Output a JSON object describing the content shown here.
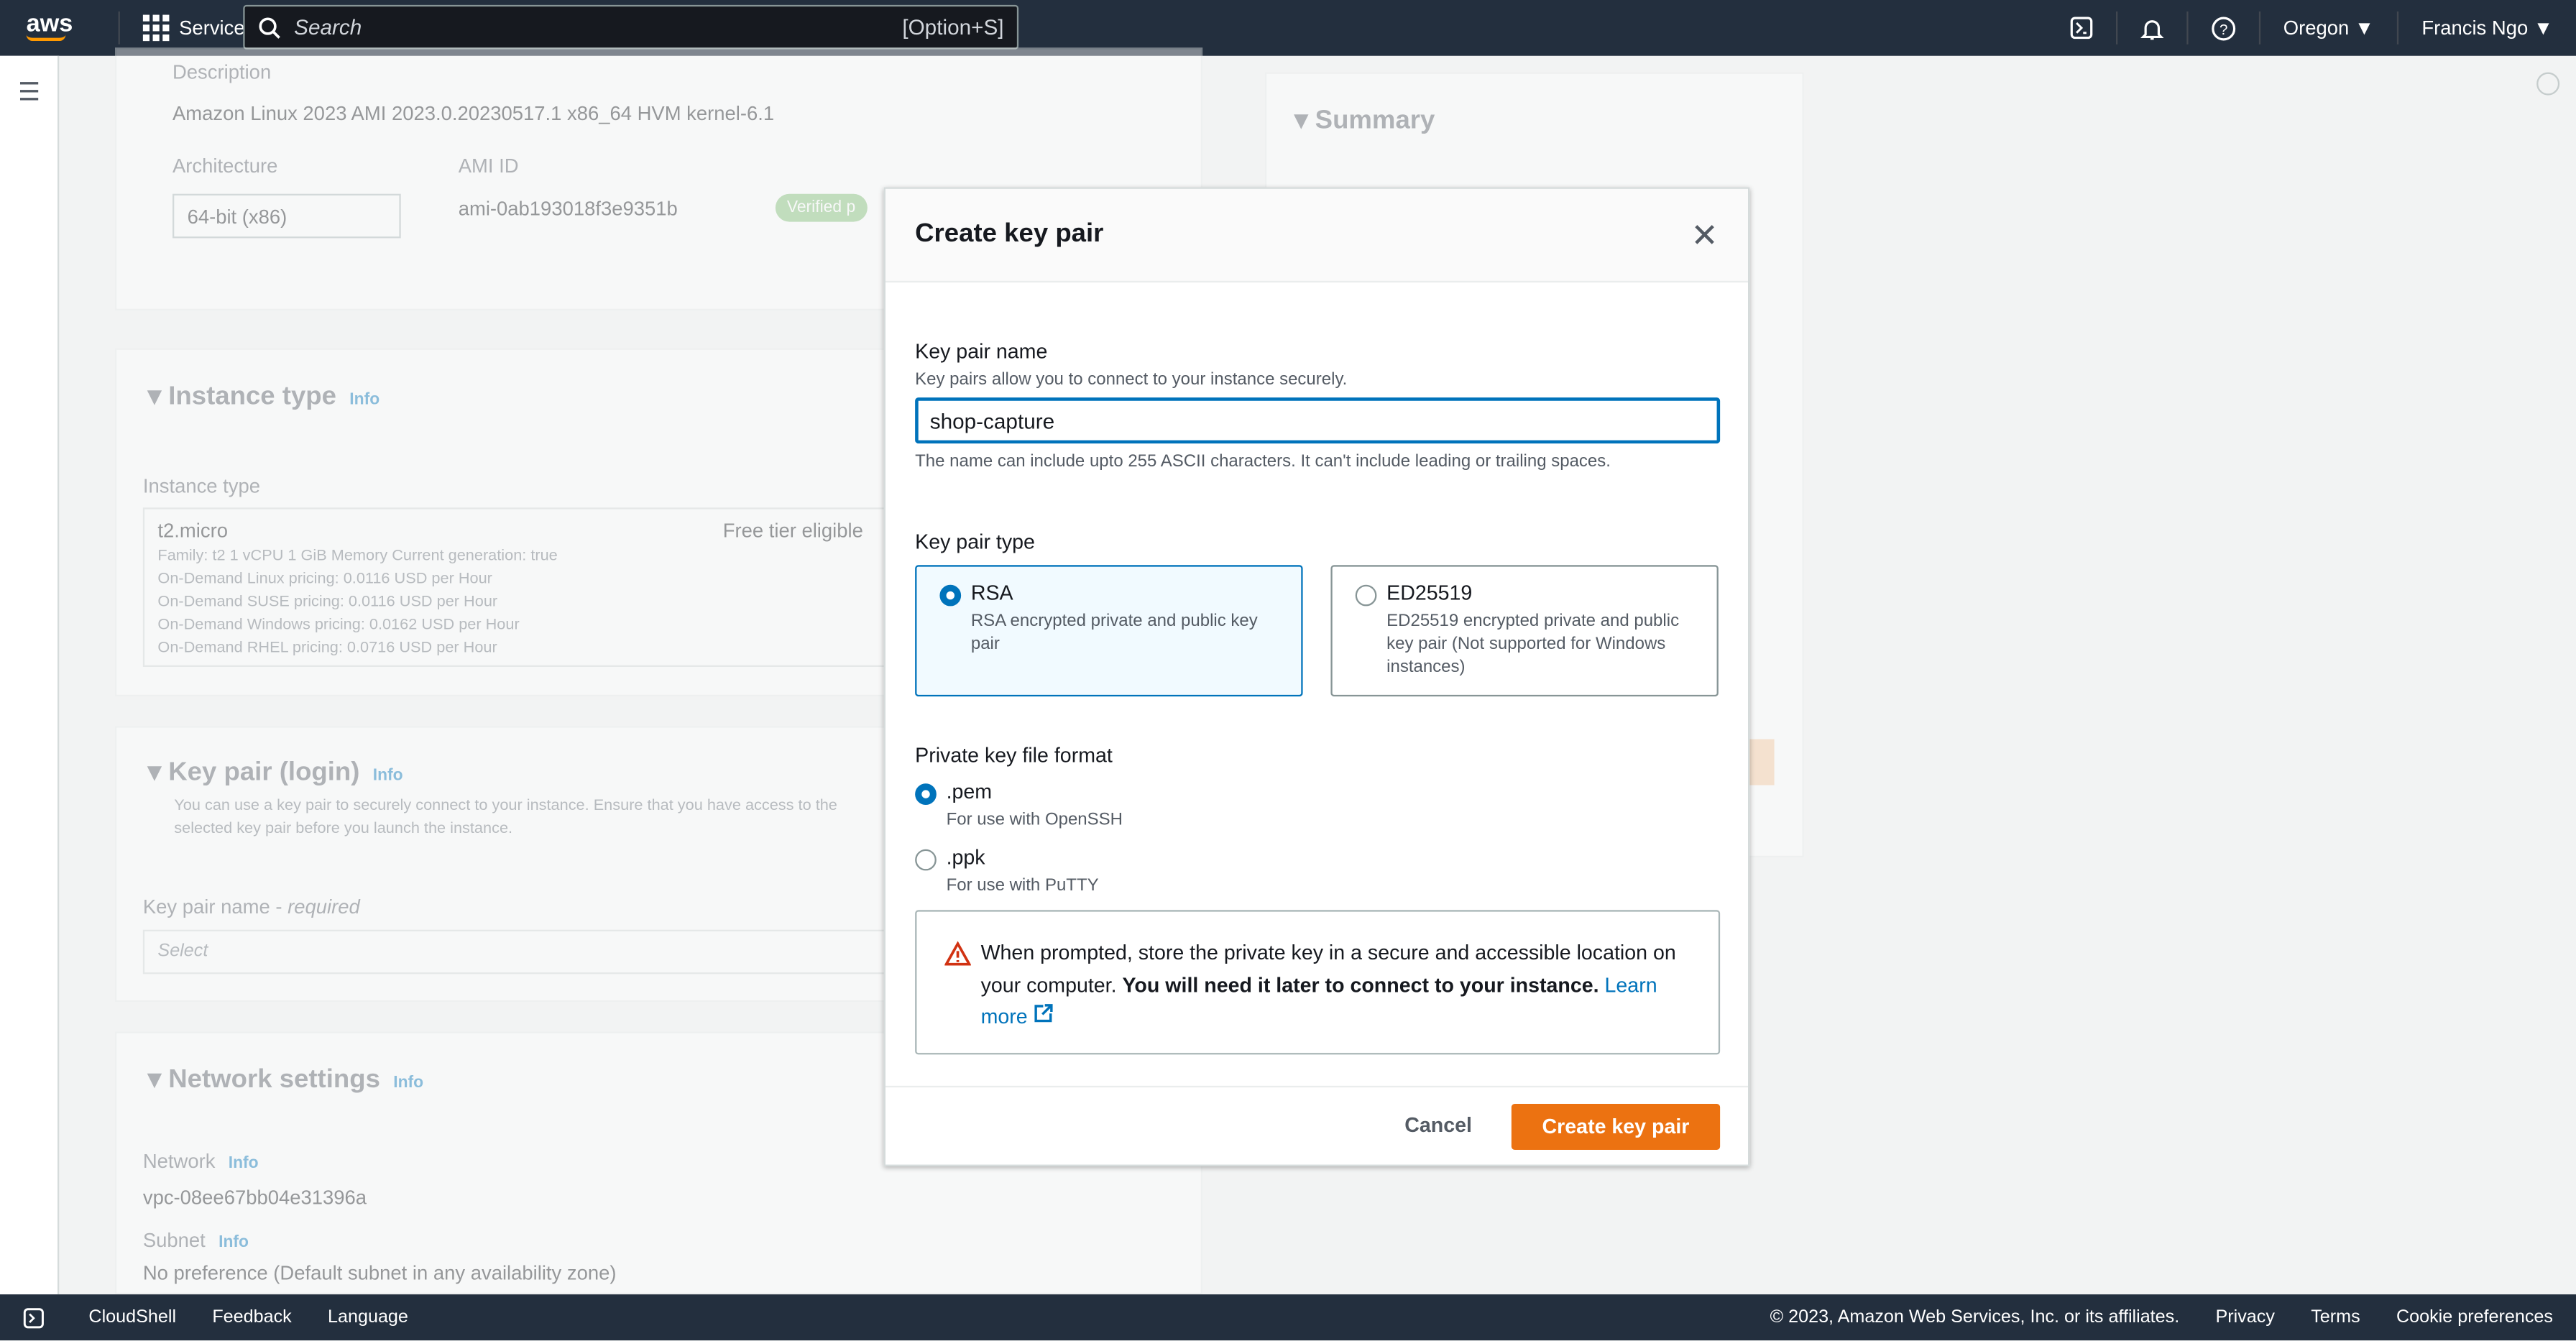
{
  "topbar": {
    "logo": "aws",
    "services": "Services",
    "search_placeholder": "Search",
    "search_shortcut": "[Option+S]",
    "region": "Oregon",
    "user": "Francis Ngo"
  },
  "background": {
    "description_label": "Description",
    "description": "Amazon Linux 2023 AMI 2023.0.20230517.1 x86_64 HVM kernel-6.1",
    "architecture_label": "Architecture",
    "architecture": "64-bit (x86)",
    "ami_id_label": "AMI ID",
    "ami_id": "ami-0ab193018f3e9351b",
    "verified": "Verified p",
    "instance_type_title": "Instance type",
    "info": "Info",
    "instance_type_label": "Instance type",
    "instance_type": "t2.micro",
    "free_tier": "Free tier eligible",
    "instance_details": [
      "Family: t2    1 vCPU    1 GiB Memory    Current generation: true",
      "On-Demand Linux pricing: 0.0116 USD per Hour",
      "On-Demand SUSE pricing: 0.0116 USD per Hour",
      "On-Demand Windows pricing: 0.0162 USD per Hour",
      "On-Demand RHEL pricing: 0.0716 USD per Hour"
    ],
    "key_pair_title": "Key pair (login)",
    "key_pair_desc": "You can use a key pair to securely connect to your instance. Ensure that you have access to the selected key pair before you launch the instance.",
    "key_pair_name_label": "Key pair name - ",
    "required": "required",
    "select": "Select",
    "network_title": "Network settings",
    "network_label": "Network",
    "network": "vpc-08ee67bb04e31396a",
    "subnet_label": "Subnet",
    "subnet": "No preference (Default subnet in any availability zone)",
    "summary": "Summary"
  },
  "modal": {
    "title": "Create key pair",
    "name_label": "Key pair name",
    "name_desc": "Key pairs allow you to connect to your instance securely.",
    "name_value": "shop-capture",
    "name_hint": "The name can include upto 255 ASCII characters. It can't include leading or trailing spaces.",
    "type_label": "Key pair type",
    "types": [
      {
        "label": "RSA",
        "desc": "RSA encrypted private and public key pair",
        "selected": true
      },
      {
        "label": "ED25519",
        "desc": "ED25519 encrypted private and public key pair (Not supported for Windows instances)",
        "selected": false
      }
    ],
    "format_label": "Private key file format",
    "formats": [
      {
        "label": ".pem",
        "desc": "For use with OpenSSH",
        "selected": true
      },
      {
        "label": ".ppk",
        "desc": "For use with PuTTY",
        "selected": false
      }
    ],
    "warning_text": "When prompted, store the private key in a secure and accessible location on your computer. ",
    "warning_bold": "You will need it later to connect to your instance.",
    "learn_more": "Learn more",
    "cancel": "Cancel",
    "create": "Create key pair"
  },
  "footer": {
    "cloudshell": "CloudShell",
    "feedback": "Feedback",
    "language": "Language",
    "copyright": "© 2023, Amazon Web Services, Inc. or its affiliates.",
    "privacy": "Privacy",
    "terms": "Terms",
    "cookies": "Cookie preferences"
  },
  "colors": {
    "accent": "#0073bb",
    "primary_button": "#ec7211",
    "topbar": "#232f3e",
    "warning": "#d13212"
  }
}
